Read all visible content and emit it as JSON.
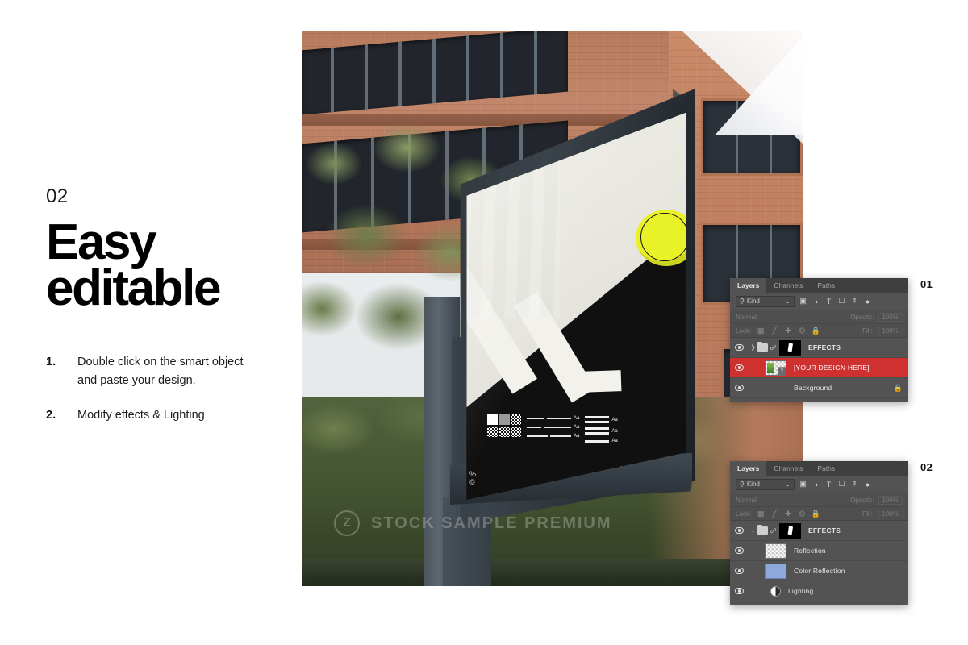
{
  "slide": {
    "step_number": "02",
    "headline_line1": "Easy",
    "headline_line2": "editable",
    "instructions": [
      {
        "index": "1.",
        "text": "Double click on the smart object and paste your design."
      },
      {
        "index": "2.",
        "text": "Modify effects & Lighting"
      }
    ]
  },
  "photo": {
    "watermark_badge": "Z",
    "watermark_text": "STOCK SAMPLE PREMIUM",
    "poster": {
      "logo_line1": "%",
      "logo_line2": "©"
    }
  },
  "panels": [
    {
      "id": "01",
      "index_label": "01",
      "tabs": [
        {
          "label": "Layers",
          "active": true
        },
        {
          "label": "Channels",
          "active": false
        },
        {
          "label": "Paths",
          "active": false
        }
      ],
      "filter": {
        "kind_label": "Kind",
        "search_icon": "search-icon",
        "chevron": "chevron-down-icon",
        "icons": [
          "pixel-filter-icon",
          "adjustment-filter-icon",
          "type-filter-icon",
          "shape-filter-icon",
          "smart-object-filter-icon",
          "toggle-filter-icon"
        ]
      },
      "blend": {
        "mode": "Normal",
        "opacity_label": "Opacity:",
        "opacity_value": "100%"
      },
      "lock": {
        "label": "Lock:",
        "fill_label": "Fill:",
        "fill_value": "100%",
        "icons": [
          "lock-transparency-icon",
          "lock-image-icon",
          "lock-position-icon",
          "lock-artboard-icon",
          "lock-all-icon"
        ]
      },
      "rows": [
        {
          "name": "EFFECTS",
          "type": "group",
          "visible": true,
          "selected": false,
          "locked": false,
          "expanded": false
        },
        {
          "name": "[YOUR DESIGN HERE]",
          "type": "smart-object",
          "visible": true,
          "selected": true,
          "locked": false
        },
        {
          "name": "Background",
          "type": "photo",
          "visible": true,
          "selected": false,
          "locked": true
        }
      ]
    },
    {
      "id": "02",
      "index_label": "02",
      "tabs": [
        {
          "label": "Layers",
          "active": true
        },
        {
          "label": "Channels",
          "active": false
        },
        {
          "label": "Paths",
          "active": false
        }
      ],
      "filter": {
        "kind_label": "Kind",
        "search_icon": "search-icon",
        "chevron": "chevron-down-icon",
        "icons": [
          "pixel-filter-icon",
          "adjustment-filter-icon",
          "type-filter-icon",
          "shape-filter-icon",
          "smart-object-filter-icon",
          "toggle-filter-icon"
        ]
      },
      "blend": {
        "mode": "Normal",
        "opacity_label": "Opacity:",
        "opacity_value": "100%"
      },
      "lock": {
        "label": "Lock:",
        "fill_label": "Fill:",
        "fill_value": "100%",
        "icons": [
          "lock-transparency-icon",
          "lock-image-icon",
          "lock-position-icon",
          "lock-artboard-icon",
          "lock-all-icon"
        ]
      },
      "rows": [
        {
          "name": "EFFECTS",
          "type": "group",
          "visible": true,
          "selected": false,
          "locked": false,
          "expanded": true
        },
        {
          "name": "Reflection",
          "type": "transparent",
          "visible": true,
          "selected": false,
          "locked": false
        },
        {
          "name": "Color Reflection",
          "type": "color",
          "visible": true,
          "selected": false,
          "locked": false
        },
        {
          "name": "Lighting",
          "type": "adjustment",
          "visible": true,
          "selected": false,
          "locked": false
        }
      ]
    }
  ],
  "colors": {
    "panel_bg": "#535353",
    "panel_tabs_bg": "#3f3f3f",
    "selected_row": "#cf3030",
    "color_reflection_swatch": "#8fa8dc",
    "poster_yellow": "#e9f227",
    "text_dark": "#111111"
  }
}
